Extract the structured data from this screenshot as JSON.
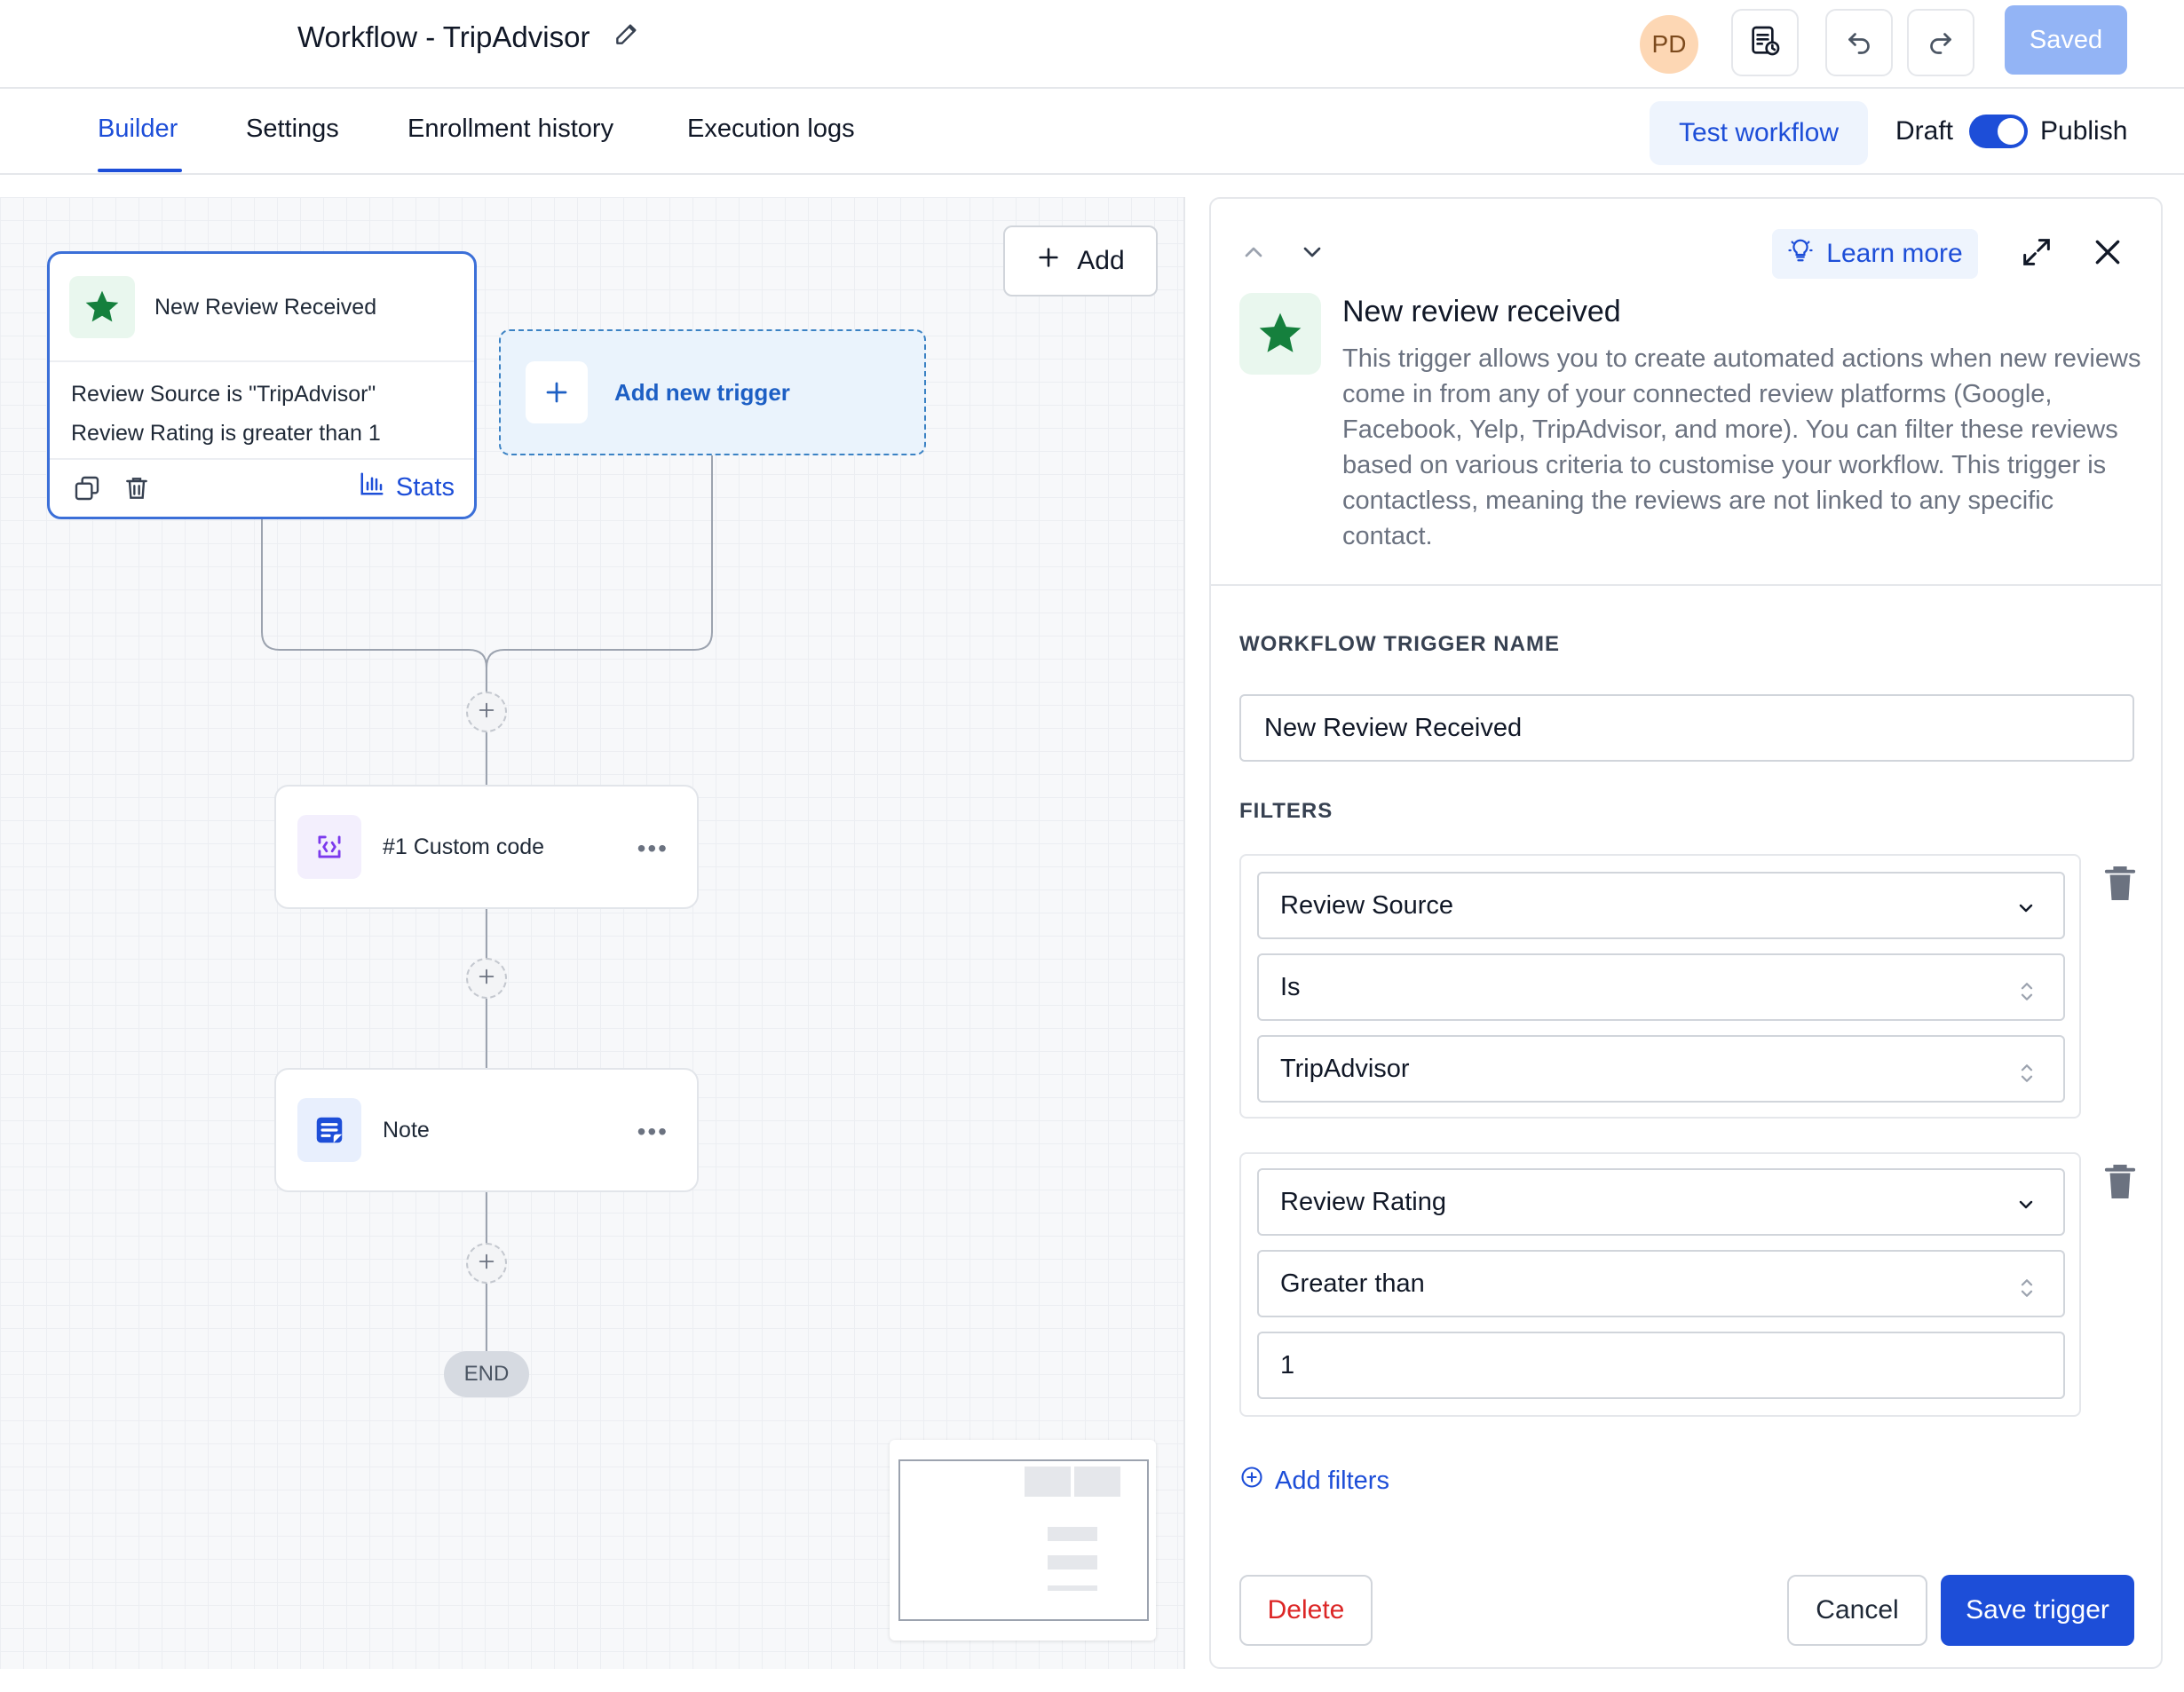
{
  "header": {
    "title": "Workflow - TripAdvisor",
    "avatar_initials": "PD",
    "saved_label": "Saved"
  },
  "tabs": [
    {
      "label": "Builder",
      "active": true
    },
    {
      "label": "Settings"
    },
    {
      "label": "Enrollment history"
    },
    {
      "label": "Execution logs"
    }
  ],
  "toolbar": {
    "test_label": "Test workflow",
    "draft_label": "Draft",
    "publish_label": "Publish",
    "publish_on": true
  },
  "canvas": {
    "add_label": "Add",
    "trigger": {
      "title": "New Review Received",
      "conditions": [
        "Review Source is \"TripAdvisor\"",
        "Review Rating is greater than 1"
      ],
      "stats_label": "Stats"
    },
    "new_trigger_label": "Add new trigger",
    "actions": [
      {
        "label": "#1 Custom code",
        "icon": "code-icon"
      },
      {
        "label": "Note",
        "icon": "note-icon"
      }
    ],
    "end_label": "END"
  },
  "panel": {
    "learn_more": "Learn more",
    "title": "New review received",
    "description": "This trigger allows you to create automated actions when new reviews come in from any of your connected review platforms (Google, Facebook, Yelp, TripAdvisor, and more). You can filter these reviews based on various criteria to customise your workflow. This trigger is contactless, meaning the reviews are not linked to any specific contact.",
    "name_label": "WORKFLOW TRIGGER NAME",
    "name_value": "New Review Received",
    "filters_label": "FILTERS",
    "filters": [
      {
        "field": "Review Source",
        "operator": "Is",
        "value": "TripAdvisor"
      },
      {
        "field": "Review Rating",
        "operator": "Greater than",
        "value": "1"
      }
    ],
    "add_filters": "Add filters",
    "delete_label": "Delete",
    "cancel_label": "Cancel",
    "save_label": "Save trigger"
  },
  "colors": {
    "accent": "#1d4ed8",
    "success": "#15803d",
    "danger": "#dc2626"
  }
}
